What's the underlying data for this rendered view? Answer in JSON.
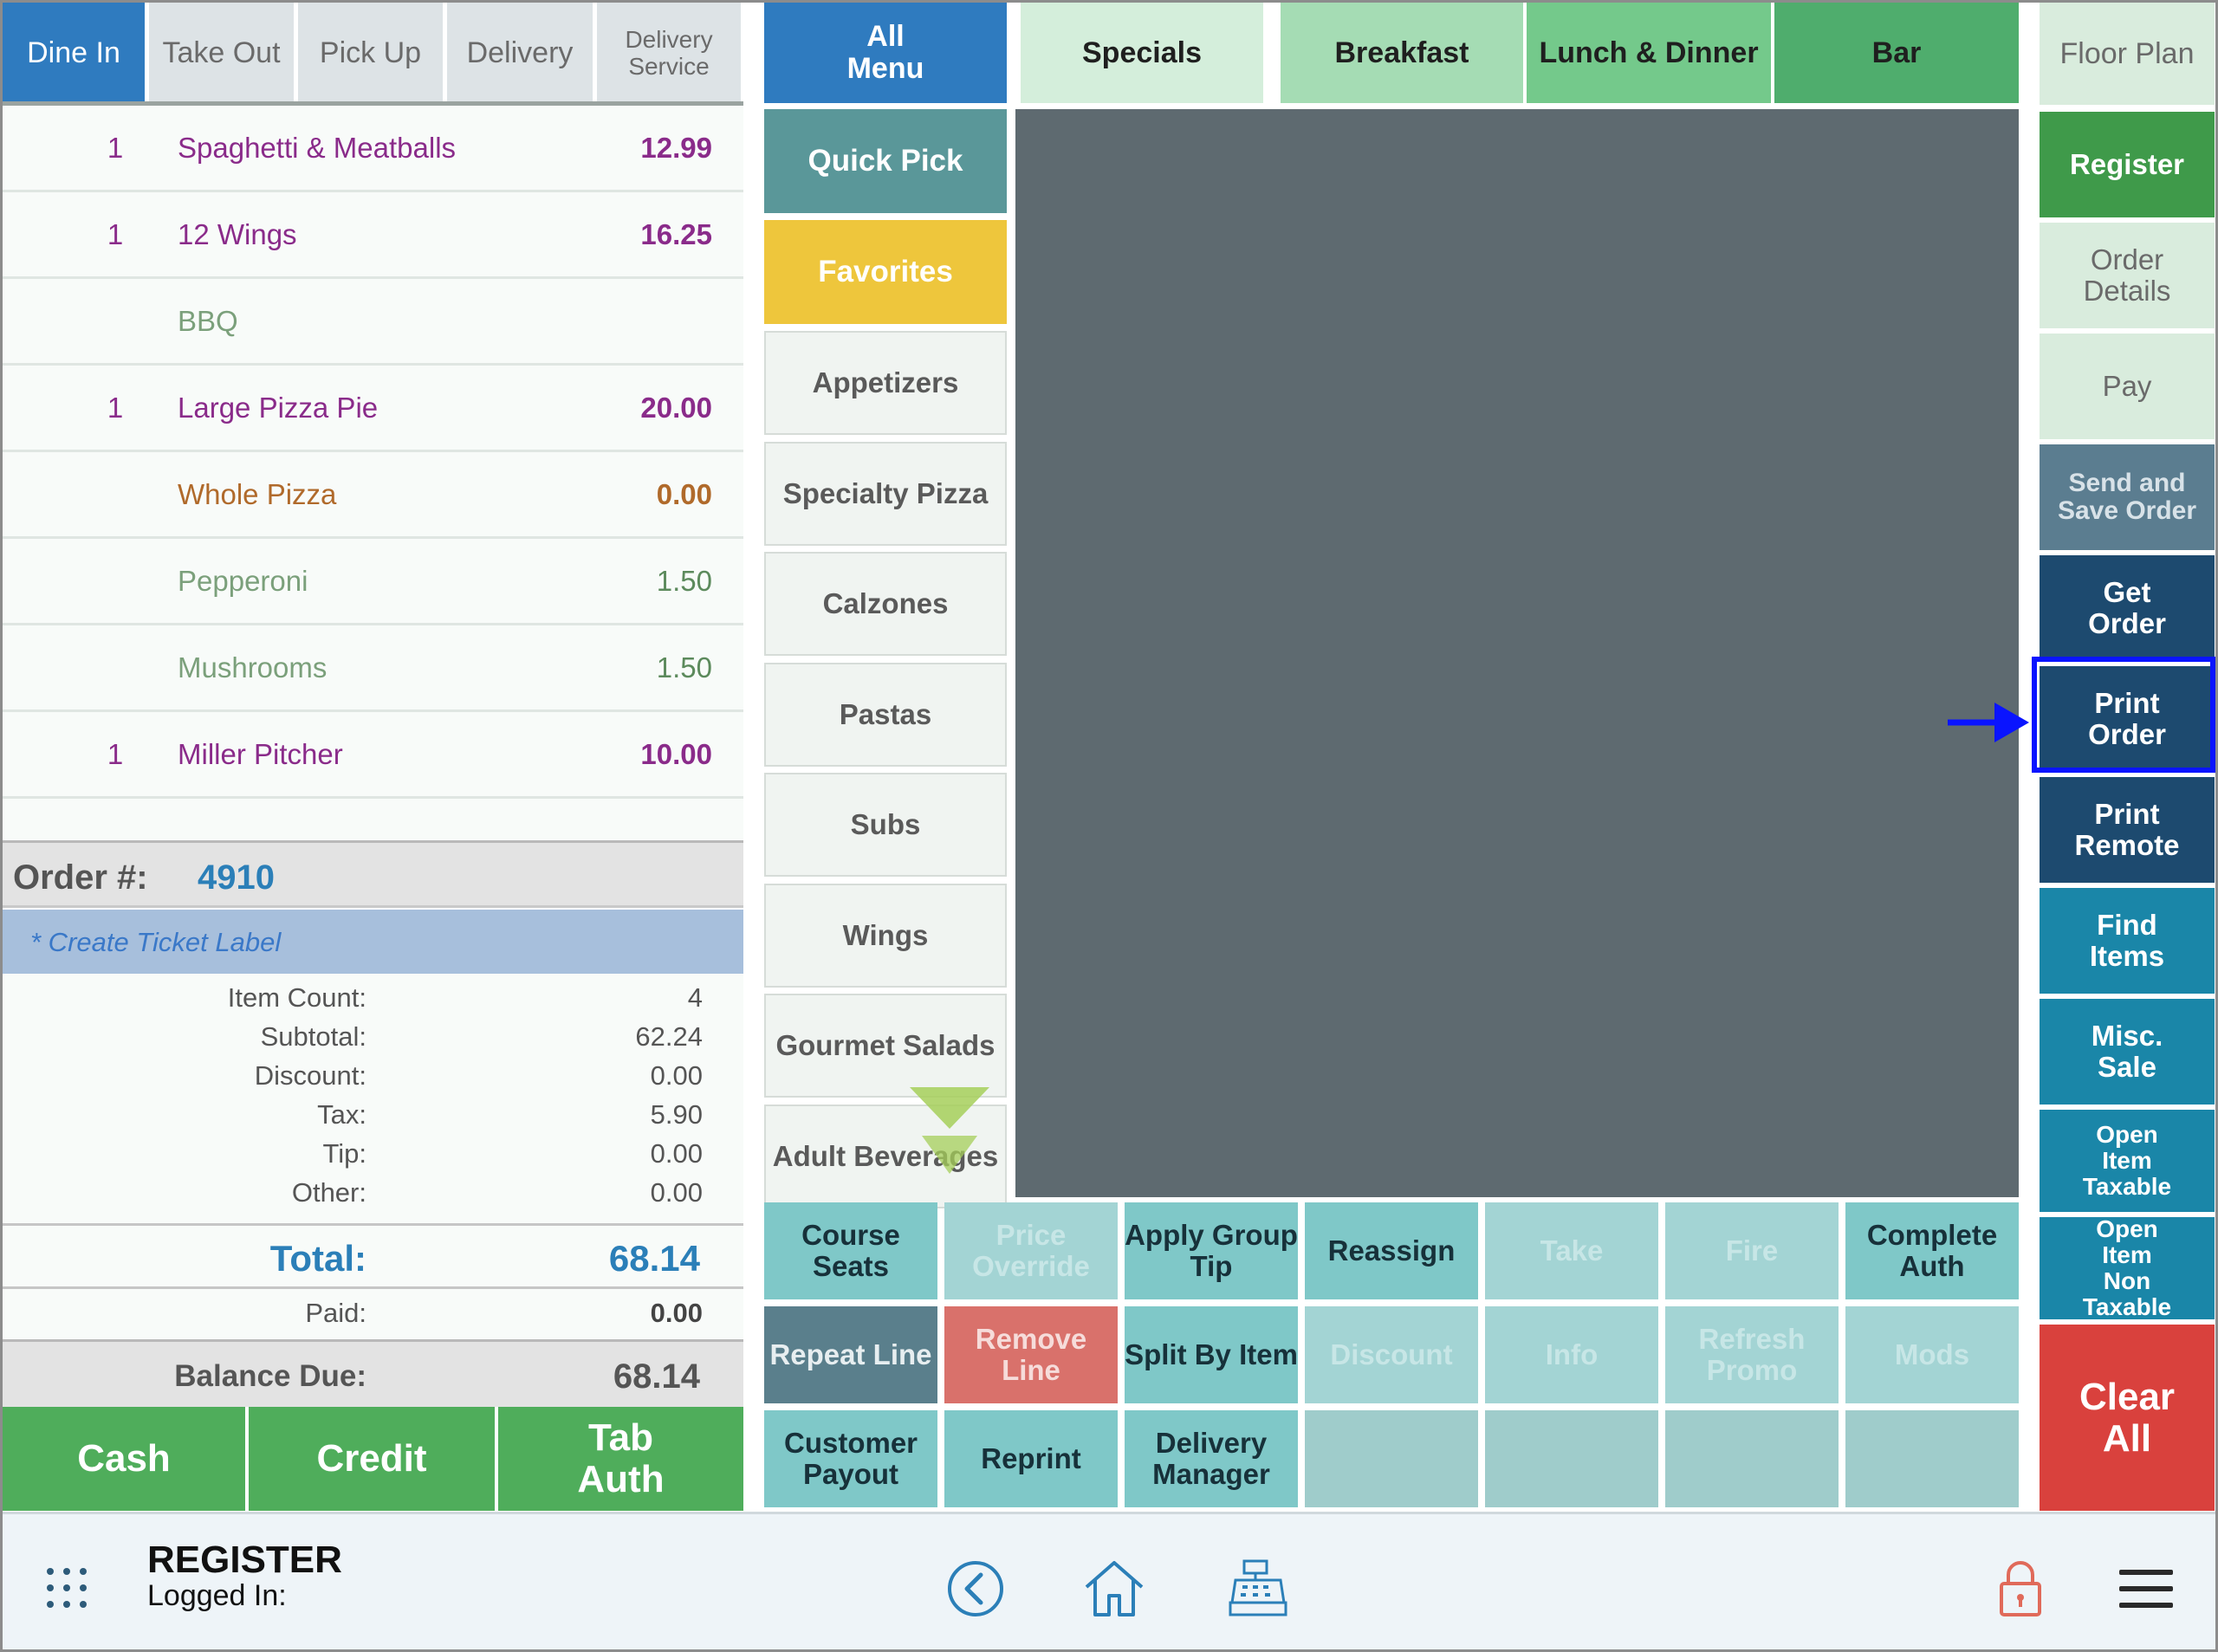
{
  "order_tabs": [
    {
      "label": "Dine In"
    },
    {
      "label": "Take Out"
    },
    {
      "label": "Pick Up"
    },
    {
      "label": "Delivery"
    },
    {
      "label": "Delivery Service"
    }
  ],
  "order_items": [
    {
      "qty": "1",
      "name": "Spaghetti & Meatballs",
      "price": "12.99"
    },
    {
      "qty": "1",
      "name": "12 Wings",
      "price": "16.25"
    },
    {
      "qty": "",
      "name": "BBQ",
      "price": ""
    },
    {
      "qty": "1",
      "name": "Large Pizza Pie",
      "price": "20.00"
    },
    {
      "qty": "",
      "name": "Whole Pizza",
      "price": "0.00"
    },
    {
      "qty": "",
      "name": "Pepperoni",
      "price": "1.50"
    },
    {
      "qty": "",
      "name": "Mushrooms",
      "price": "1.50"
    },
    {
      "qty": "1",
      "name": "Miller Pitcher",
      "price": "10.00"
    }
  ],
  "order": {
    "number_label": "Order #:",
    "number": "4910",
    "ticket_label": "* Create Ticket Label"
  },
  "summary": {
    "item_count_label": "Item Count:",
    "item_count": "4",
    "subtotal_label": "Subtotal:",
    "subtotal": "62.24",
    "discount_label": "Discount:",
    "discount": "0.00",
    "tax_label": "Tax:",
    "tax": "5.90",
    "tip_label": "Tip:",
    "tip": "0.00",
    "other_label": "Other:",
    "other": "0.00",
    "total_label": "Total:",
    "total": "68.14",
    "paid_label": "Paid:",
    "paid": "0.00",
    "balance_label": "Balance Due:",
    "balance": "68.14"
  },
  "payment_buttons": {
    "cash": "Cash",
    "credit": "Credit",
    "tab_auth": "Tab Auth"
  },
  "menu_tabs": {
    "all_menu": "All Menu",
    "specials": "Specials",
    "breakfast": "Breakfast",
    "lunch_dinner": "Lunch & Dinner",
    "bar": "Bar"
  },
  "categories": {
    "quick_pick": "Quick Pick",
    "favorites": "Favorites",
    "appetizers": "Appetizers",
    "specialty_pizza": "Specialty Pizza",
    "calzones": "Calzones",
    "pastas": "Pastas",
    "subs": "Subs",
    "wings": "Wings",
    "gourmet_salads": "Gourmet Salads",
    "adult_beverages": "Adult Beverages"
  },
  "right_buttons": {
    "floor_plan": "Floor Plan",
    "register": "Register",
    "order_details": "Order Details",
    "pay": "Pay",
    "send_save": "Send and Save Order",
    "get_order": "Get Order",
    "print_order": "Print Order",
    "print_remote": "Print Remote",
    "find_items": "Find Items",
    "misc_sale": "Misc. Sale",
    "open_item_taxable": "Open Item Taxable",
    "open_item_non_taxable": "Open Item Non Taxable",
    "clear_all": "Clear All"
  },
  "action_grid": {
    "course_seats": "Course Seats",
    "price_override": "Price Override",
    "apply_group_tip": "Apply Group Tip",
    "reassign": "Reassign",
    "take": "Take",
    "fire": "Fire",
    "complete_auth": "Complete Auth",
    "repeat_line": "Repeat Line",
    "remove_line": "Remove Line",
    "split_by_item": "Split By Item",
    "discount": "Discount",
    "info": "Info",
    "refresh_promo": "Refresh Promo",
    "mods": "Mods",
    "customer_payout": "Customer Payout",
    "reprint": "Reprint",
    "delivery_manager": "Delivery Manager"
  },
  "footer": {
    "title": "REGISTER",
    "logged_in": "Logged In:"
  },
  "icons": {
    "apps": "grid-icon",
    "back": "back-circle-icon",
    "home": "home-icon",
    "register": "cash-register-icon",
    "lock": "lock-icon",
    "menu": "hamburger-icon",
    "annotation": "arrow-icon"
  },
  "colors": {
    "active_tab": "#2f7bbf",
    "green_pay": "#4fad5b",
    "navy": "#1d4a6f",
    "teal_dark": "#1a86a8",
    "red": "#d9413d",
    "highlight": "#0a14ff"
  }
}
